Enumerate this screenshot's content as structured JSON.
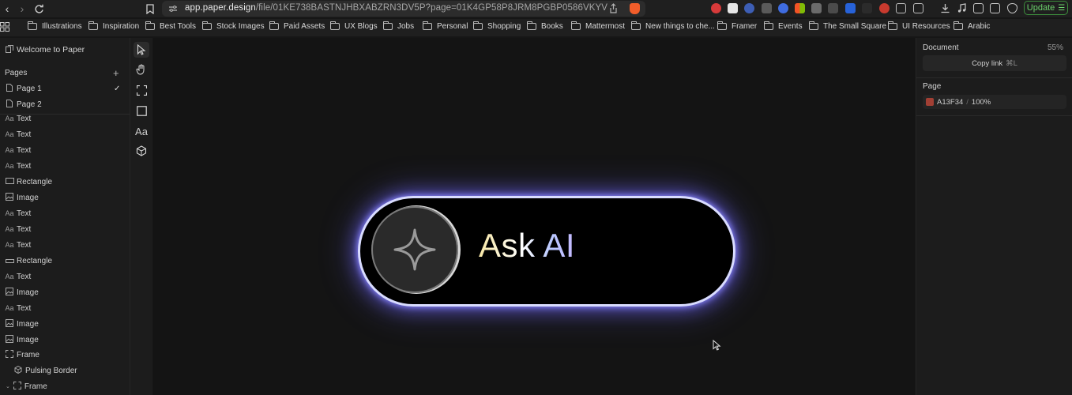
{
  "browser": {
    "url": "app.paper.design/file/01KE738BASTNJHBXABZRN3DV5P?page=01K4GP58P8JRM8PGBP0586VKYV",
    "url_host": "app.paper.design",
    "url_path": "/file/01KE738BASTNJHBXABZRN3DV5P?page=01K4GP58P8JRM8PGBP0586VKYV",
    "update_label": "Update"
  },
  "bookmarks": [
    {
      "label": "Illustrations"
    },
    {
      "label": "Inspiration"
    },
    {
      "label": "Best Tools"
    },
    {
      "label": "Stock Images"
    },
    {
      "label": "Paid Assets"
    },
    {
      "label": "UX Blogs"
    },
    {
      "label": "Jobs"
    },
    {
      "label": "Personal"
    },
    {
      "label": "Shopping"
    },
    {
      "label": "Books"
    },
    {
      "label": "Mattermost"
    },
    {
      "label": "New things to che..."
    },
    {
      "label": "Framer"
    },
    {
      "label": "Events"
    },
    {
      "label": "The Small Square"
    },
    {
      "label": "UI Resources"
    },
    {
      "label": "Arabic"
    }
  ],
  "left_panel": {
    "file_title": "Welcome to Paper",
    "pages_heading": "Pages",
    "pages": [
      {
        "label": "Page 1",
        "selected": true
      },
      {
        "label": "Page 2",
        "selected": false
      }
    ],
    "layers": [
      {
        "icon": "text-icon",
        "label": "Text"
      },
      {
        "icon": "text-icon",
        "label": "Text"
      },
      {
        "icon": "text-icon",
        "label": "Text"
      },
      {
        "icon": "text-icon",
        "label": "Text"
      },
      {
        "icon": "rectangle-icon",
        "label": "Rectangle"
      },
      {
        "icon": "image-icon",
        "label": "Image"
      },
      {
        "icon": "text-icon",
        "label": "Text"
      },
      {
        "icon": "text-icon",
        "label": "Text"
      },
      {
        "icon": "text-icon",
        "label": "Text"
      },
      {
        "icon": "rectangle-icon",
        "label": "Rectangle"
      },
      {
        "icon": "text-icon",
        "label": "Text"
      },
      {
        "icon": "image-icon",
        "label": "Image"
      },
      {
        "icon": "text-icon",
        "label": "Text"
      },
      {
        "icon": "image-icon",
        "label": "Image"
      },
      {
        "icon": "image-icon",
        "label": "Image"
      },
      {
        "icon": "frame-icon",
        "label": "Frame"
      },
      {
        "icon": "shader-icon",
        "label": "Pulsing Border"
      },
      {
        "icon": "frame-icon",
        "label": "Frame"
      }
    ],
    "text_icon_glyph": "Aa"
  },
  "canvas": {
    "button_label": "Ask AI"
  },
  "right_panel": {
    "document_heading": "Document",
    "zoom": "55%",
    "copy_link_label": "Copy link",
    "copy_link_shortcut": "⌘L",
    "page_heading": "Page",
    "page_fill_hex": "A13F34",
    "page_fill_separator": "/",
    "page_fill_opacity": "100%",
    "page_fill_color": "#A13F34"
  }
}
